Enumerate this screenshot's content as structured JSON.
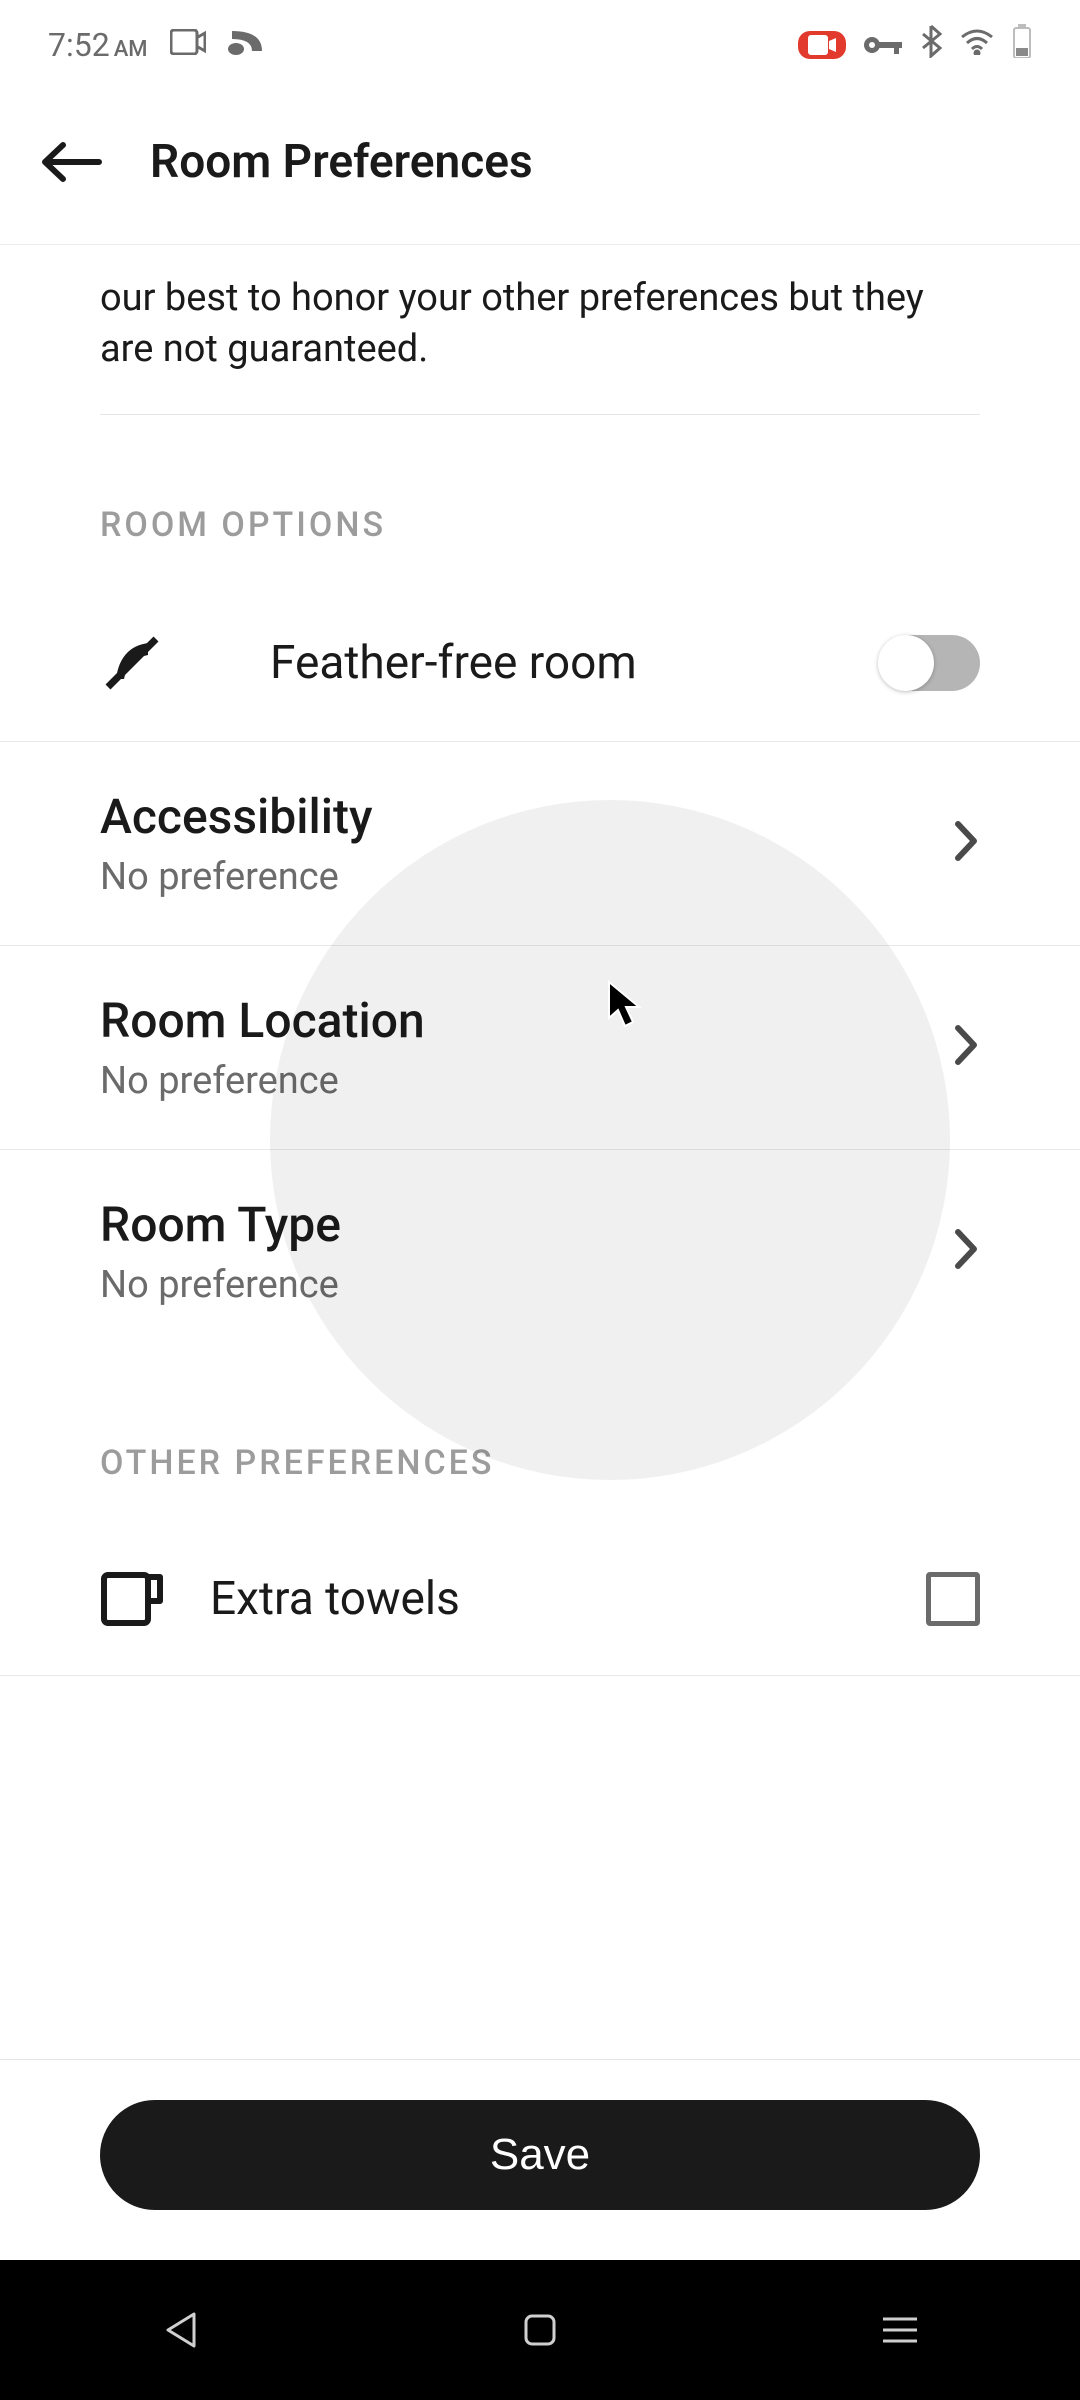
{
  "status": {
    "time": "7:52",
    "ampm": "AM"
  },
  "header": {
    "title": "Room Preferences"
  },
  "info_text": "our best to honor your other preferences but they are not guaranteed.",
  "sections": {
    "room_options_header": "ROOM OPTIONS",
    "other_prefs_header": "OTHER PREFERENCES"
  },
  "feather_free": {
    "label": "Feather-free room",
    "enabled": false
  },
  "accessibility": {
    "title": "Accessibility",
    "value": "No preference"
  },
  "room_location": {
    "title": "Room Location",
    "value": "No preference"
  },
  "room_type": {
    "title": "Room Type",
    "value": "No preference"
  },
  "extra_towels": {
    "label": "Extra towels",
    "checked": false
  },
  "save_label": "Save"
}
